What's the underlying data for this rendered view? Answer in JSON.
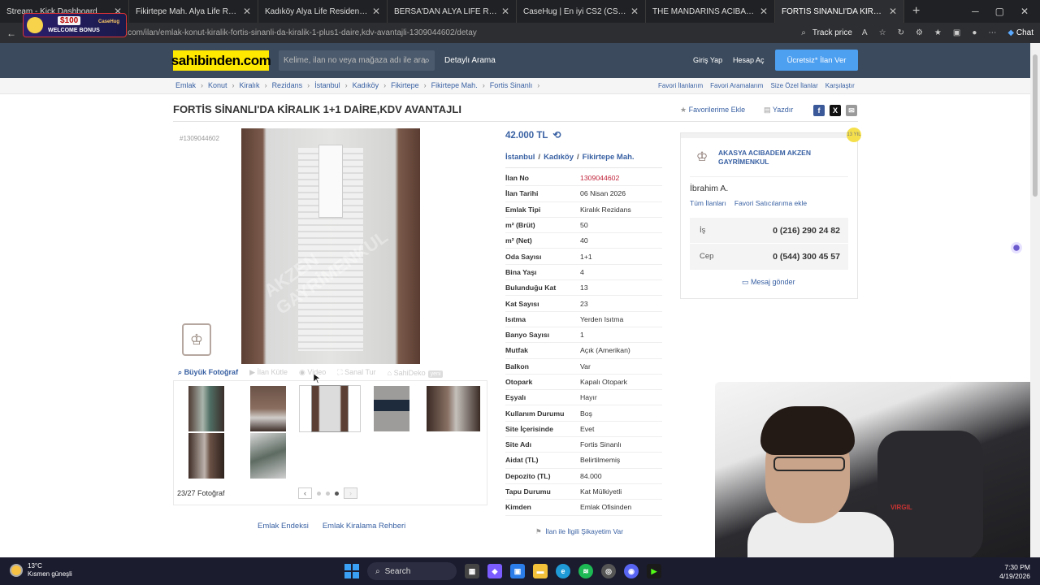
{
  "browser": {
    "tabs": [
      {
        "label": "Stream - Kick Dashboard",
        "fav": "K",
        "favcolor": "#53fc18",
        "active": false
      },
      {
        "label": "Fikirtepe Mah. Alya Life Residence",
        "fav": "S",
        "favcolor": "#ffe800",
        "active": false
      },
      {
        "label": "Kadıköy Alya Life Residence Ferah",
        "fav": "S",
        "favcolor": "#ffe800",
        "active": false
      },
      {
        "label": "BERSA'DAN ALYA LİFE RESİDENCE",
        "fav": "S",
        "favcolor": "#ffe800",
        "active": false
      },
      {
        "label": "CaseHug | En iyi CS2 (CS:GO) kasa",
        "fav": "C",
        "favcolor": "#e0447c",
        "active": false
      },
      {
        "label": "THE MANDARINS ACIBADEM DE",
        "fav": "S",
        "favcolor": "#ffe800",
        "active": false
      },
      {
        "label": "FORTİS SİNANLI'DA KİRALIK 1+1",
        "fav": "S",
        "favcolor": "#ffe800",
        "active": true
      }
    ],
    "url": "https://www.sahibinden.com/ilan/emlak-konut-kiralik-fortis-sinanli-da-kiralik-1-plus1-daire,kdv-avantajli-1309044602/detay",
    "track_price": "Track price",
    "chat": "Chat"
  },
  "stream_overlay": {
    "amount": "$100",
    "label": "WELCOME BONUS",
    "casino": "CaseHug"
  },
  "header": {
    "logo": "sahibinden.com",
    "search_placeholder": "Kelime, ilan no veya mağaza adı ile ara",
    "detailed_search": "Detaylı Arama",
    "login": "Giriş Yap",
    "register": "Hesap Aç",
    "post_ad": "Ücretsiz* İlan Ver"
  },
  "breadcrumb": {
    "items": [
      "Emlak",
      "Konut",
      "Kiralık",
      "Rezidans",
      "İstanbul",
      "Kadıköy",
      "Fikirtepe",
      "Fikirtepe Mah.",
      "Fortis Sinanlı"
    ],
    "right": [
      "Favori İlanlarım",
      "Favori Aramalarım",
      "Size Özel İlanlar",
      "Karşılaştır"
    ]
  },
  "listing": {
    "title": "FORTİS SİNANLI'DA KİRALIK 1+1 DAİRE,KDV AVANTAJLI",
    "add_favorite": "Favorilerime Ekle",
    "print": "Yazdır",
    "listing_no_tag": "#1309044602",
    "watermark": "AKZEN GAYRİMENKUL",
    "price": "42.000 TL",
    "location": [
      "İstanbul",
      "Kadıköy",
      "Fikirtepe Mah."
    ],
    "gallery_tabs": [
      {
        "label": "Büyük Fotoğraf",
        "enabled": true
      },
      {
        "label": "İlan Kütle",
        "enabled": false
      },
      {
        "label": "Video",
        "enabled": false
      },
      {
        "label": "Sanal Tur",
        "enabled": false
      },
      {
        "label": "SahiDeko",
        "enabled": false
      }
    ],
    "new_badge": "yeni",
    "photo_count": "23/27 Fotoğraf",
    "properties": [
      {
        "k": "İlan No",
        "v": "1309044602",
        "red": true
      },
      {
        "k": "İlan Tarihi",
        "v": "06 Nisan 2026"
      },
      {
        "k": "Emlak Tipi",
        "v": "Kiralık Rezidans"
      },
      {
        "k": "m² (Brüt)",
        "v": "50"
      },
      {
        "k": "m² (Net)",
        "v": "40"
      },
      {
        "k": "Oda Sayısı",
        "v": "1+1"
      },
      {
        "k": "Bina Yaşı",
        "v": "4"
      },
      {
        "k": "Bulunduğu Kat",
        "v": "13"
      },
      {
        "k": "Kat Sayısı",
        "v": "23"
      },
      {
        "k": "Isıtma",
        "v": "Yerden Isıtma"
      },
      {
        "k": "Banyo Sayısı",
        "v": "1"
      },
      {
        "k": "Mutfak",
        "v": "Açık (Amerikan)"
      },
      {
        "k": "Balkon",
        "v": "Var"
      },
      {
        "k": "Otopark",
        "v": "Kapalı Otopark"
      },
      {
        "k": "Eşyalı",
        "v": "Hayır"
      },
      {
        "k": "Kullanım Durumu",
        "v": "Boş"
      },
      {
        "k": "Site İçerisinde",
        "v": "Evet"
      },
      {
        "k": "Site Adı",
        "v": "Fortis Sinanlı"
      },
      {
        "k": "Aidat (TL)",
        "v": "Belirtilmemiş"
      },
      {
        "k": "Depozito (TL)",
        "v": "84.000"
      },
      {
        "k": "Tapu Durumu",
        "v": "Kat Mülkiyetli"
      },
      {
        "k": "Kimden",
        "v": "Emlak Ofisinden"
      }
    ],
    "complain": "İlan ile İlgili Şikayetim Var",
    "bottom_links": [
      "Emlak Endeksi",
      "Emlak Kiralama Rehberi"
    ]
  },
  "agency": {
    "badge": "13 YIL",
    "name": "AKASYA ACIBADEM AKZEN GAYRİMENKUL",
    "agent": "İbrahim A.",
    "all_listings": "Tüm İlanları",
    "add_fav_seller": "Favori Satıcılarıma ekle",
    "phones": [
      {
        "type": "İş",
        "number": "0 (216) 290 24 82"
      },
      {
        "type": "Cep",
        "number": "0 (544) 300 45 57"
      }
    ],
    "message": "Mesaj gönder"
  },
  "webcam": {
    "chair_brand": "VIRGIL"
  },
  "taskbar": {
    "temp": "13°C",
    "weather": "Kısmen güneşli",
    "search": "Search",
    "time": "7:30 PM",
    "date": "4/19/2026"
  },
  "colors": {
    "brand_yellow": "#ffe800",
    "header_bg": "#3b4a5c",
    "link": "#3961a3",
    "cta": "#4d9ff0"
  }
}
